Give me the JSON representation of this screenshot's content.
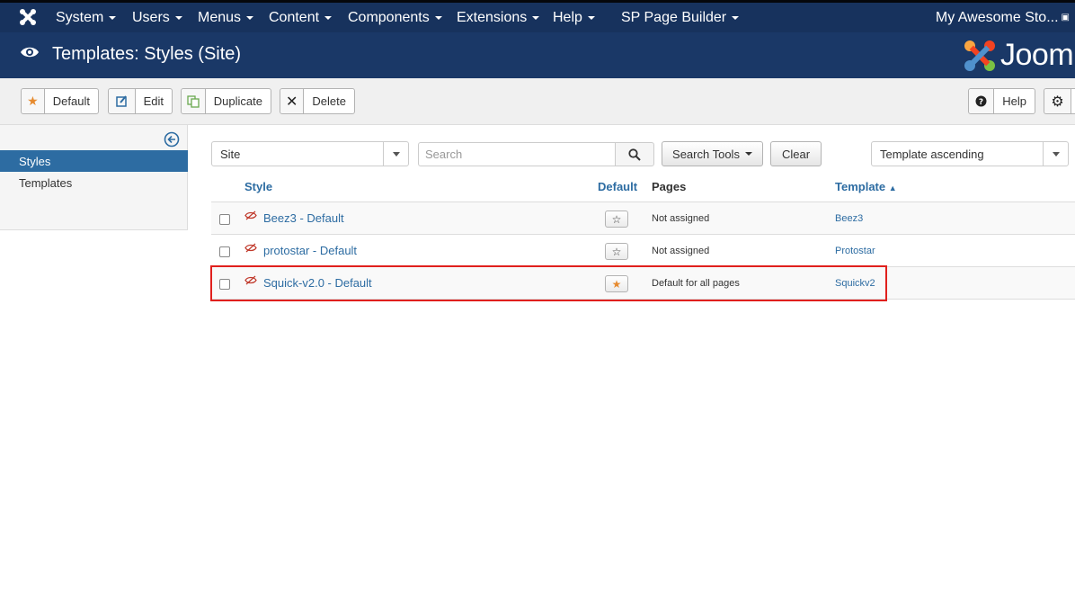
{
  "colors": {
    "nav_bg": "#17325d",
    "header_bg": "#1a3867",
    "link": "#2d6ca2",
    "star_default": "#e68a2e",
    "highlight": "#e0201d"
  },
  "nav": {
    "logo_icon": "joomla-icon",
    "menus": [
      "System",
      "Users",
      "Menus",
      "Content",
      "Components",
      "Extensions",
      "Help",
      "SP Page Builder"
    ],
    "site_name": "My Awesome Sto..."
  },
  "header": {
    "title": "Templates: Styles (Site)",
    "icon": "eye-icon",
    "logo_text": "Joom"
  },
  "toolbar": {
    "default_label": "Default",
    "edit_label": "Edit",
    "duplicate_label": "Duplicate",
    "delete_label": "Delete",
    "help_label": "Help"
  },
  "sidebar": {
    "items": [
      {
        "label": "Styles",
        "active": true
      },
      {
        "label": "Templates",
        "active": false
      }
    ]
  },
  "filters": {
    "client_select": "Site",
    "search_placeholder": "Search",
    "search_tools_label": "Search Tools",
    "clear_label": "Clear",
    "ordering_select": "Template ascending"
  },
  "table": {
    "headers": {
      "style": "Style",
      "default": "Default",
      "pages": "Pages",
      "template": "Template"
    },
    "sort_indicator": "ascending",
    "rows": [
      {
        "name": "Beez3 - Default",
        "is_default": false,
        "pages": "Not assigned",
        "template": "Beez3"
      },
      {
        "name": "protostar - Default",
        "is_default": false,
        "pages": "Not assigned",
        "template": "Protostar"
      },
      {
        "name": "Squick-v2.0 - Default",
        "is_default": true,
        "pages": "Default for all pages",
        "template": "Squickv2"
      }
    ]
  }
}
